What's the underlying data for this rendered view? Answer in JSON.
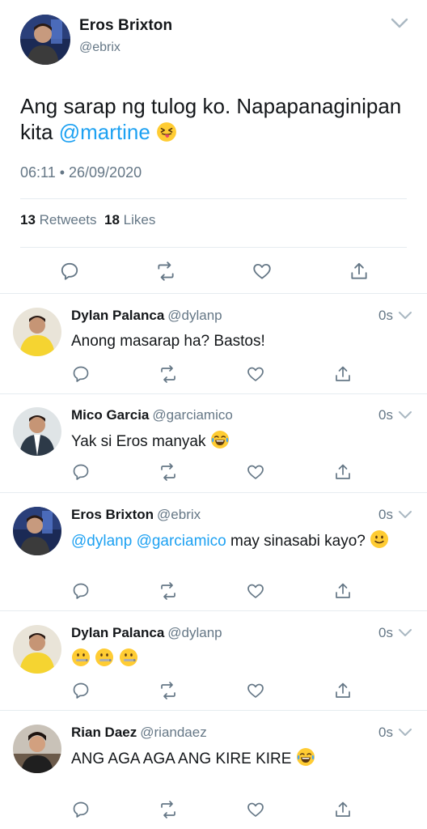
{
  "main_tweet": {
    "author_name": "Eros Brixton",
    "author_handle": "@ebrix",
    "text_part1": "Ang sarap ng tulog ko. Napapanaginipan kita ",
    "mention": "@martine",
    "emoji": "squinting-tongue-face",
    "timestamp": "06:11 • 26/09/2020",
    "retweets_count": "13",
    "retweets_label": "Retweets",
    "likes_count": "18",
    "likes_label": "Likes"
  },
  "replies": [
    {
      "name": "Dylan Palanca",
      "handle": "@dylanp",
      "time": "0s",
      "text": "Anong masarap ha? Bastos!"
    },
    {
      "name": "Mico Garcia",
      "handle": "@garciamico",
      "time": "0s",
      "text": "Yak si Eros manyak ",
      "emoji": "tears-of-joy-face"
    },
    {
      "name": "Eros Brixton",
      "handle": "@ebrix",
      "time": "0s",
      "mention1": "@dylanp",
      "mention2": "@garciamico",
      "text": " may sinasabi kayo?",
      "emoji": "slightly-smiling-face"
    },
    {
      "name": "Dylan Palanca",
      "handle": "@dylanp",
      "time": "0s",
      "emoji": "zipper-mouth-face x3"
    },
    {
      "name": "Rian Daez",
      "handle": "@riandaez",
      "time": "0s",
      "text": "ANG AGA AGA ANG KIRE KIRE ",
      "emoji": "tears-of-joy-face"
    }
  ],
  "colors": {
    "accent": "#1da1f2",
    "secondary_text": "#657786",
    "primary_text": "#14171a",
    "divider": "#e6ecf0",
    "icon": "#657786"
  }
}
